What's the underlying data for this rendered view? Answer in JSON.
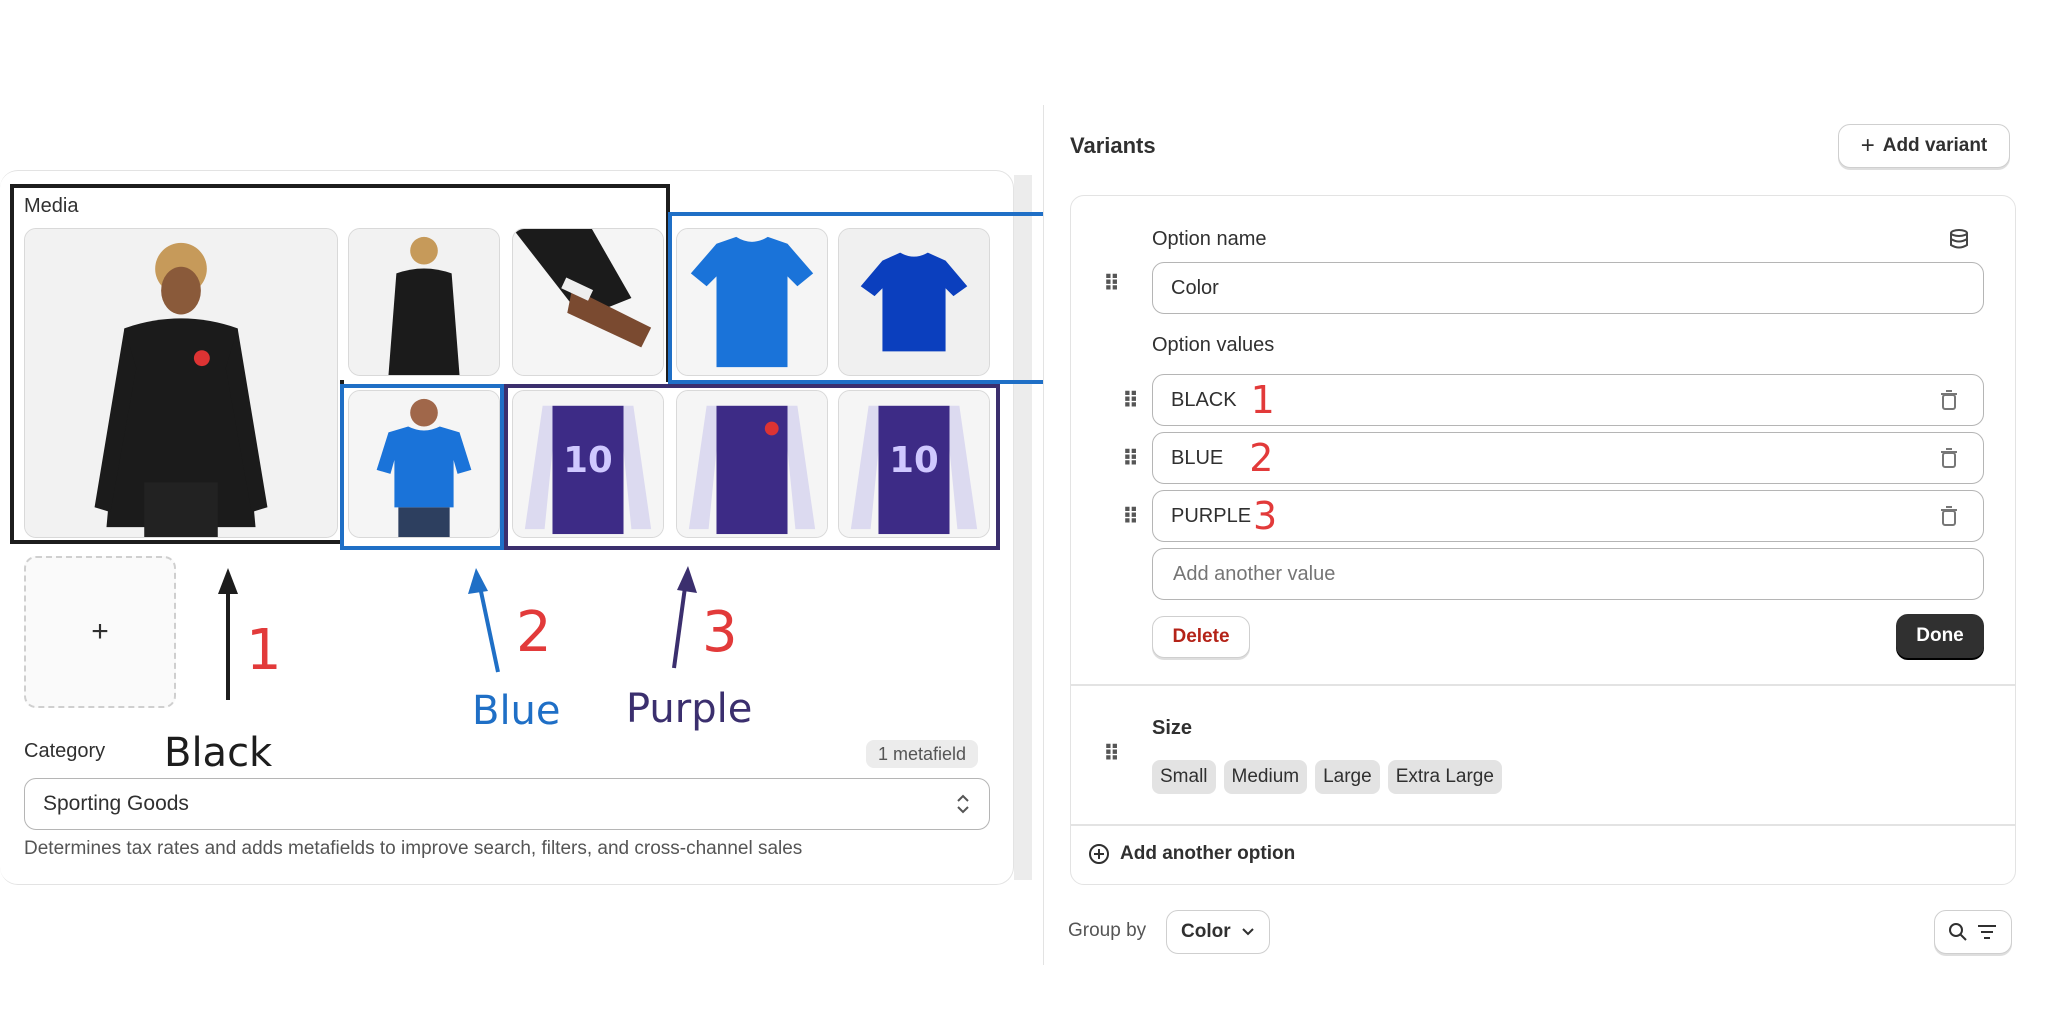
{
  "media": {
    "label": "Media",
    "add_symbol": "+"
  },
  "annotations": {
    "num1": "1",
    "num2": "2",
    "num3": "3",
    "black": "Black",
    "blue": "Blue",
    "purple": "Purple"
  },
  "category": {
    "label": "Category",
    "metafield": "1 metafield",
    "value": "Sporting Goods",
    "help": "Determines tax rates and adds metafields to improve search, filters, and cross-channel sales"
  },
  "variants": {
    "title": "Variants",
    "add_variant": "Add variant",
    "option_name_label": "Option name",
    "option_name_value": "Color",
    "option_values_label": "Option values",
    "values": [
      {
        "text": "BLACK",
        "mark": "1"
      },
      {
        "text": "BLUE",
        "mark": "2"
      },
      {
        "text": "PURPLE",
        "mark": "3"
      }
    ],
    "add_value_placeholder": "Add another value",
    "delete": "Delete",
    "done": "Done",
    "size_label": "Size",
    "sizes": [
      "Small",
      "Medium",
      "Large",
      "Extra Large"
    ],
    "add_option": "Add another option",
    "group_by_label": "Group by",
    "group_by_value": "Color"
  },
  "colors": {
    "annotation_red": "#e23a3a",
    "annotation_blue": "#1f6fc6",
    "annotation_purple": "#3b2f6e",
    "jersey_purple": "#3d2b86",
    "shirt_blue": "#1a73d9"
  },
  "icons": {
    "add": "plus-icon",
    "drag": "drag-handle-icon",
    "trash": "trash-icon",
    "metafield": "database-icon",
    "select": "chevron-updown-icon",
    "add_option": "plus-circle-icon",
    "group_chevron": "chevron-down-icon",
    "search": "search-icon",
    "filter": "filter-icon"
  }
}
